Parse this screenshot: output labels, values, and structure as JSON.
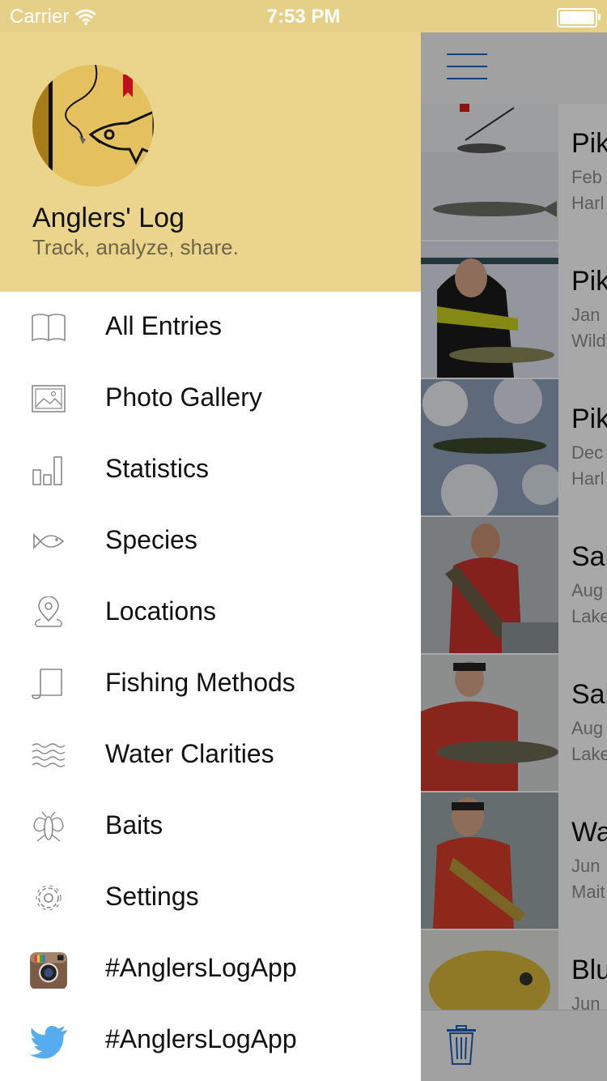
{
  "status_bar": {
    "carrier": "Carrier",
    "time": "7:53 PM"
  },
  "drawer": {
    "app_name": "Anglers' Log",
    "tagline": "Track, analyze, share.",
    "items": [
      {
        "label": "All Entries",
        "icon": "book-icon"
      },
      {
        "label": "Photo Gallery",
        "icon": "photo-icon"
      },
      {
        "label": "Statistics",
        "icon": "bar-chart-icon"
      },
      {
        "label": "Species",
        "icon": "fish-icon"
      },
      {
        "label": "Locations",
        "icon": "location-pin-icon"
      },
      {
        "label": "Fishing Methods",
        "icon": "scroll-icon"
      },
      {
        "label": "Water Clarities",
        "icon": "waves-icon"
      },
      {
        "label": "Baits",
        "icon": "fly-icon"
      },
      {
        "label": "Settings",
        "icon": "gear-icon"
      },
      {
        "label": "#AnglersLogApp",
        "icon": "instagram-icon"
      },
      {
        "label": "#AnglersLogApp",
        "icon": "twitter-icon"
      }
    ]
  },
  "entries": [
    {
      "title": "Pik",
      "date": "Feb",
      "location": "Harl"
    },
    {
      "title": "Pik",
      "date": "Jan",
      "location": "Wild"
    },
    {
      "title": "Pik",
      "date": "Dec",
      "location": "Harl"
    },
    {
      "title": "Sal",
      "date": "Aug",
      "location": "Lake"
    },
    {
      "title": "Sal",
      "date": "Aug",
      "location": "Lake"
    },
    {
      "title": "Wa",
      "date": "Jun",
      "location": "Mait"
    },
    {
      "title": "Blu",
      "date": "Jun",
      "location": ""
    }
  ],
  "colors": {
    "header": "#ebd58c",
    "status_bar": "#e6cf86",
    "accent": "#1d5fb8",
    "twitter": "#55acee"
  }
}
